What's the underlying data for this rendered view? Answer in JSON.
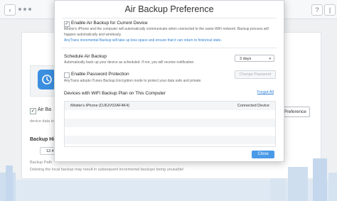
{
  "background": {
    "top_right_buttons": [
      "?",
      "|"
    ],
    "air_backup_label": "Air Ba",
    "device_note": "device data in",
    "preference_button": "Preference",
    "backup_history_label": "Backup His",
    "backup_size_button": "12.4",
    "backup_path_label": "Backup Path",
    "warning_text": "Deleting the local backup may result in subsequent incremental backups being unusable!"
  },
  "modal": {
    "title": "Air Backup Preference",
    "enable_air_backup": {
      "checked": true,
      "label": "Enable Air Backup for Current Device",
      "description": "iMobie's iPhone and the computer will automatically communicate when connected to the same WiFi network. Backup process will happen automatically and wirelessly.",
      "note": "AnyTrans incremental Backup will take up less space and ensure that it can return to historical state."
    },
    "schedule": {
      "label": "Schedule Air Backup",
      "description": "Automatically back up your device as scheduled. If not, you will receive notification.",
      "selected_value": "3 days"
    },
    "password": {
      "checked": false,
      "label": "Enable Password Protection",
      "description": "AnyTrans adopts iTunes Backup Encryption mode to protect your data safe and private.",
      "change_button": "Change Password"
    },
    "devices": {
      "label": "Devices with WiFi Backup Plan on This Computer",
      "forgot_link": "Forgot All",
      "rows": [
        {
          "name": "iMobie's iPhone (DJ6JV02AF4K4)",
          "status": "Connected Device"
        }
      ]
    },
    "close_button": "Close"
  },
  "colors": {
    "accent": "#4a9ae8",
    "link": "#2f7fd6"
  }
}
